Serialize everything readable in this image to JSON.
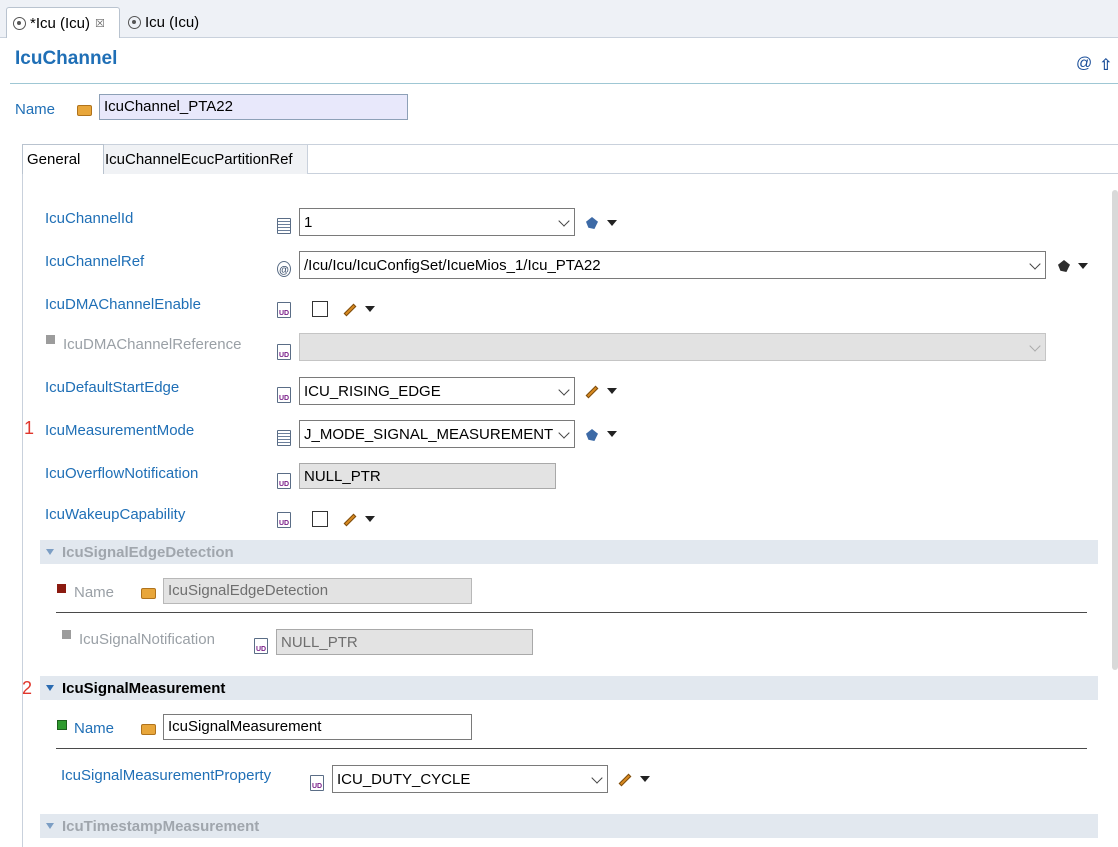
{
  "editor_tabs": [
    {
      "label": "*Icu (Icu)",
      "close": "☒"
    },
    {
      "label": "Icu (Icu)"
    }
  ],
  "header": {
    "title": "IcuChannel",
    "at_icon": "@",
    "up_icon": "⇧"
  },
  "name_field": {
    "label": "Name",
    "value": "IcuChannel_PTA22"
  },
  "inner_tabs": [
    "General",
    "IcuChannelEcucPartitionRef"
  ],
  "fields": {
    "channel_id": {
      "label": "IcuChannelId",
      "value": "1"
    },
    "channel_ref": {
      "label": "IcuChannelRef",
      "value": "/Icu/Icu/IcuConfigSet/IcueMios_1/Icu_PTA22"
    },
    "dma_enable": {
      "label": "IcuDMAChannelEnable"
    },
    "dma_reference": {
      "label": "IcuDMAChannelReference",
      "value": ""
    },
    "default_start_edge": {
      "label": "IcuDefaultStartEdge",
      "value": "ICU_RISING_EDGE"
    },
    "measurement_mode": {
      "label": "IcuMeasurementMode",
      "value": "J_MODE_SIGNAL_MEASUREMENT",
      "marker": "1"
    },
    "overflow_notification": {
      "label": "IcuOverflowNotification",
      "value": "NULL_PTR"
    },
    "wakeup_capability": {
      "label": "IcuWakeupCapability"
    }
  },
  "sections": {
    "edge_detection": {
      "title": "IcuSignalEdgeDetection",
      "name_label": "Name",
      "name_value": "IcuSignalEdgeDetection",
      "notification_label": "IcuSignalNotification",
      "notification_value": "NULL_PTR"
    },
    "signal_measurement": {
      "title": "IcuSignalMeasurement",
      "marker": "2",
      "name_label": "Name",
      "name_value": "IcuSignalMeasurement",
      "property_label": "IcuSignalMeasurementProperty",
      "property_value": "ICU_DUTY_CYCLE"
    },
    "timestamp_measurement": {
      "title": "IcuTimestampMeasurement"
    }
  },
  "colors": {
    "link_blue": "#1f6fb6",
    "marker_red": "#e0362c",
    "section_bg": "#e2e8ef"
  }
}
